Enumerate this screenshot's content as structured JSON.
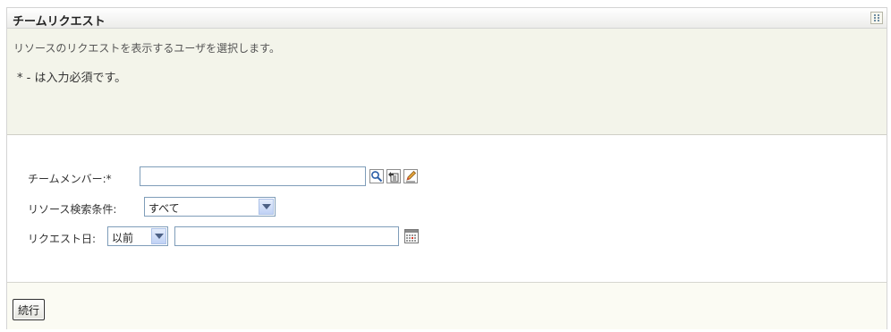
{
  "portlet": {
    "title": "チームリクエスト",
    "menu_icon": "grid-menu-icon"
  },
  "instructions": {
    "description": "リソースのリクエストを表示するユーザを選択します。",
    "required_note": "* - は入力必須です。"
  },
  "form": {
    "team_member": {
      "label": "チームメンバー:*",
      "value": "",
      "icons": [
        "search-icon",
        "history-icon",
        "edit-icon"
      ]
    },
    "resource_filter": {
      "label": "リソース検索条件:",
      "selected": "すべて"
    },
    "request_date": {
      "label": "リクエスト日:",
      "operator_selected": "以前",
      "value": "",
      "icon": "calendar-icon"
    }
  },
  "actions": {
    "continue_label": "続行"
  },
  "colors": {
    "panel_bg": "#fbfbf3",
    "description_bg": "#f3f4ea",
    "input_border": "#7f9db9",
    "select_arrow": "#c0d2f5"
  }
}
